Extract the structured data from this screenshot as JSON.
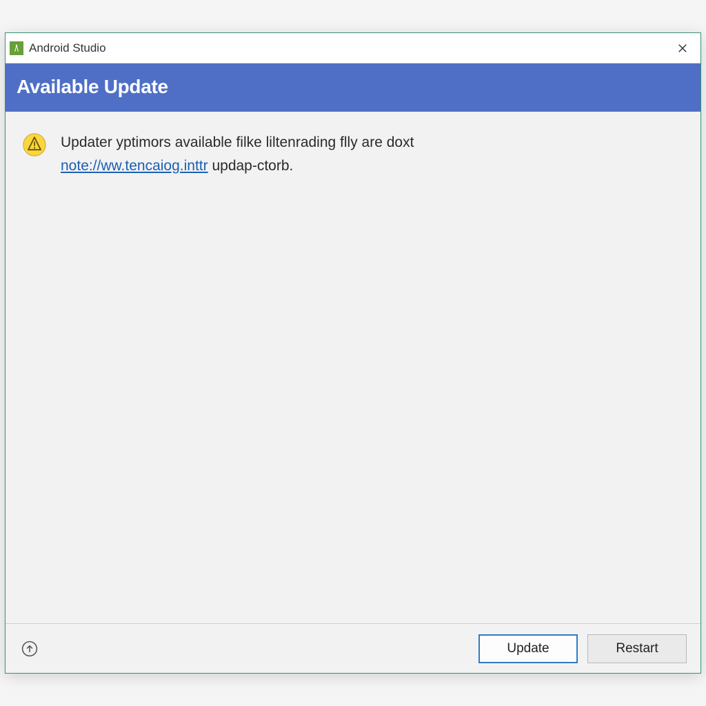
{
  "window": {
    "title": "Android Studio"
  },
  "banner": {
    "title": "Available Update"
  },
  "message": {
    "line1": "Updater yptimors available filke liltenrading flly are doxt",
    "link_text": "note://ww.tencaiog.inttr",
    "line2_suffix": " updap-ctorb."
  },
  "footer": {
    "update_label": "Update",
    "restart_label": "Restart"
  }
}
